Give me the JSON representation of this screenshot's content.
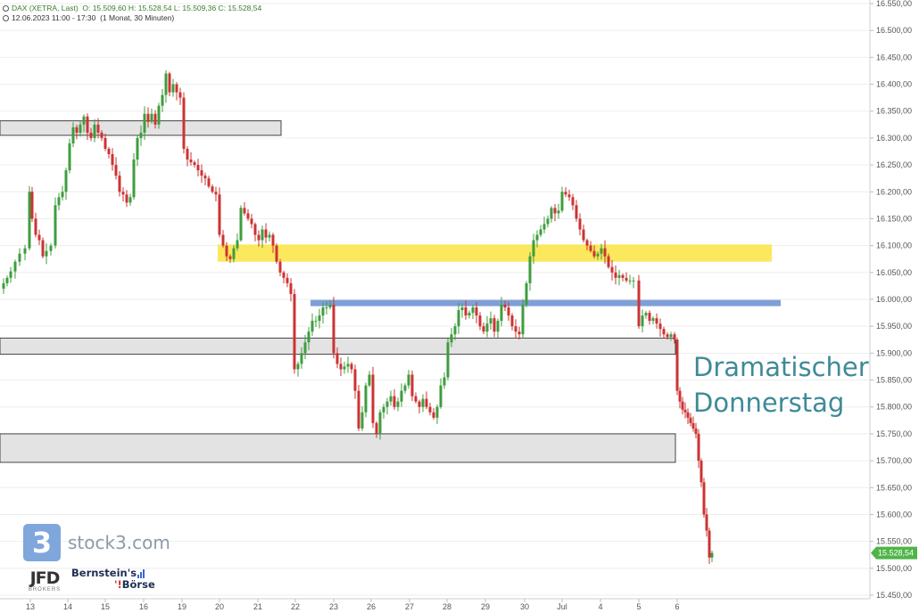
{
  "header": {
    "instrument": "DAX (XETRA, Last)",
    "ohlc": "O: 15.509,60   H: 15.528,54   L: 15.509,36   C: 15.528,54",
    "range": "12.06.2023 11:00 - 17:30",
    "interval": "(1 Monat, 30 Minuten)"
  },
  "annotation": {
    "line1": "Dramatischer",
    "line2": "Donnerstag",
    "color": "#3e8a98"
  },
  "branding": {
    "logo_glyph": "3",
    "name": "stock3.com",
    "broker": "JFD",
    "broker_sub": "BROKERS",
    "partner_line1": "Bernstein's",
    "partner_line2": "Börse"
  },
  "colors": {
    "up": "#3f9c3f",
    "down": "#cc3333",
    "zone_gray": "#e3e3e3",
    "zone_yellow": "#fbe54a",
    "line_blue": "#7f9fd8",
    "price_tag": "#4fb548"
  },
  "chart_data": {
    "type": "candlestick",
    "title": "DAX (XETRA, Last)",
    "ylim": [
      15450,
      16550
    ],
    "y_ticks": [
      15450,
      15500,
      15550,
      15600,
      15650,
      15700,
      15750,
      15800,
      15850,
      15900,
      15950,
      16000,
      16050,
      16100,
      16150,
      16200,
      16250,
      16300,
      16350,
      16400,
      16450,
      16500,
      16550
    ],
    "y_tick_labels": [
      "15.450,00",
      "15.500,00",
      "15.550,00",
      "15.600,00",
      "15.650,00",
      "15.700,00",
      "15.750,00",
      "15.800,00",
      "15.850,00",
      "15.900,00",
      "15.950,00",
      "16.000,00",
      "16.050,00",
      "16.100,00",
      "16.150,00",
      "16.200,00",
      "16.250,00",
      "16.300,00",
      "16.350,00",
      "16.400,00",
      "16.450,00",
      "16.500,00",
      "16.550,00"
    ],
    "x_labels": [
      "13",
      "14",
      "15",
      "16",
      "19",
      "20",
      "21",
      "22",
      "23",
      "26",
      "27",
      "28",
      "29",
      "30",
      "Jul",
      "4",
      "5",
      "6"
    ],
    "last_price_label": "15.528,54",
    "last_price": 15528.54,
    "key_closes": [
      {
        "date": "12.06",
        "close": 16020
      },
      {
        "date": "13.06",
        "close": 16100
      },
      {
        "date": "14.06",
        "close": 16330
      },
      {
        "date": "15.06",
        "close": 16280
      },
      {
        "date": "16.06",
        "close": 16360
      },
      {
        "date": "19.06",
        "close": 16200
      },
      {
        "date": "20.06",
        "close": 16110
      },
      {
        "date": "21.06",
        "close": 16020
      },
      {
        "date": "22.06",
        "close": 15950
      },
      {
        "date": "23.06",
        "close": 15830
      },
      {
        "date": "26.06",
        "close": 15810
      },
      {
        "date": "27.06",
        "close": 15840
      },
      {
        "date": "28.06",
        "close": 15950
      },
      {
        "date": "29.06",
        "close": 15930
      },
      {
        "date": "30.06",
        "close": 16110
      },
      {
        "date": "03.07",
        "close": 16090
      },
      {
        "date": "04.07",
        "close": 16035
      },
      {
        "date": "05.07",
        "close": 15935
      },
      {
        "date": "06.07",
        "close": 15528.54
      }
    ],
    "zones": [
      {
        "kind": "gray",
        "low": 16305,
        "high": 16332
      },
      {
        "kind": "yellow",
        "low": 16070,
        "high": 16102
      },
      {
        "kind": "blue_line",
        "value": 15994
      },
      {
        "kind": "gray",
        "low": 15898,
        "high": 15928
      },
      {
        "kind": "gray",
        "low": 15697,
        "high": 15750
      }
    ]
  }
}
